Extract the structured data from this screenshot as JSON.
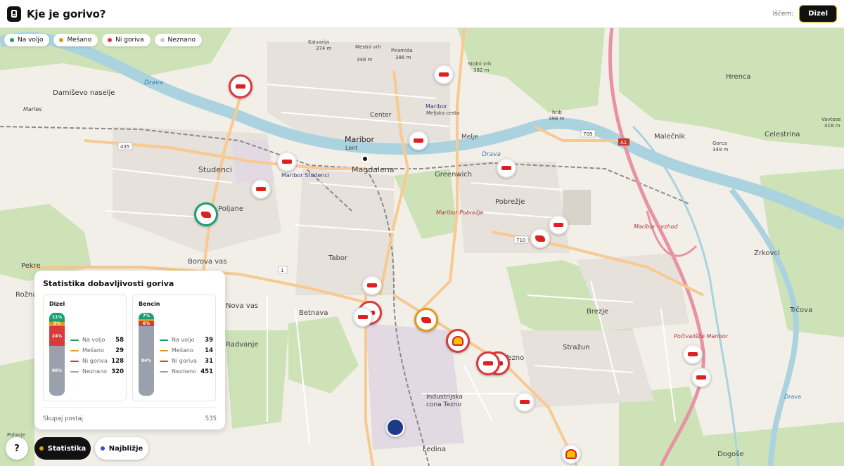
{
  "header": {
    "title": "Kje je gorivo?",
    "search_label": "Iščem:",
    "fuel_button": "Dizel"
  },
  "legend": [
    {
      "label": "Na voljo",
      "color": "#1a9e72"
    },
    {
      "label": "Mešano",
      "color": "#e09a1a"
    },
    {
      "label": "Ni goriva",
      "color": "#d93a3a"
    },
    {
      "label": "Neznano",
      "color": "#c9c9c9"
    }
  ],
  "map_labels": {
    "kalvarija": "Kalvarija",
    "kalvarija_h": "374 m",
    "mestni_vrh": "Mestni vrh",
    "mestni_vrh_h": "348 m",
    "piramida": "Piramida",
    "piramida_h": "386 m",
    "stolni_vrh": "Stolni vrh",
    "stolni_vrh_h": "382 m",
    "damisevo": "Damiševo naselje",
    "marles": "Marles",
    "maribor": "Maribor",
    "center": "Center",
    "lent": "Lent",
    "studenci": "Studenci",
    "maribor_studenci": "Maribor Studenci",
    "magdalena": "Magdalena",
    "poljane": "Poljane",
    "greenwich": "Greenwich",
    "pobrezje": "Pobrežje",
    "maribor_pobrezje": "Maribor Pobrežje",
    "melje": "Melje",
    "maribor_melje": "Maribor",
    "meljska": "Meljska cesta",
    "tabor": "Tabor",
    "borova_vas": "Borova vas",
    "nova_vas": "Nova vas",
    "betnava": "Betnava",
    "radvanje": "Radvanje",
    "brezje": "Brezje",
    "strazun": "Stražun",
    "tezno": "Tezno",
    "industrijska": "Industrijska",
    "cona_tezno": "cona Tezno",
    "ledina": "Ledina",
    "dogose": "Dogoše",
    "malecnik": "Malečnik",
    "celestrina": "Celestrina",
    "hrenca": "Hrenca",
    "zrkovci": "Zrkovci",
    "trcova": "Trčova",
    "maribor_vzhod": "Maribor - vzhod",
    "pocivalisce": "Počivališče Maribor",
    "gorca": "Gorca",
    "gorca_h": "349 m",
    "vavtose": "Vavtose",
    "vavtose_h": "418 m",
    "hrib": "hrib",
    "hrib_h": "398 m",
    "pekre": "Pekre",
    "rozna": "Rožna",
    "drava": "Drava",
    "pohorje": "Pohorje",
    "road_709": "709",
    "road_435": "435",
    "road_710": "710",
    "road_a1": "A1",
    "road_1": "1"
  },
  "stats": {
    "title": "Statistika dobavljivosti goriva",
    "total_label": "Skupaj postaj",
    "total": 535,
    "fuels": [
      {
        "name": "Dizel",
        "rows": [
          {
            "label": "Na voljo",
            "value": 58,
            "color": "#1a9e72",
            "pct": "11%"
          },
          {
            "label": "Mešano",
            "value": 29,
            "color": "#e09a1a",
            "pct": "5%"
          },
          {
            "label": "Ni goriva",
            "value": 128,
            "color": "#d93a3a",
            "pct": "24%"
          },
          {
            "label": "Neznano",
            "value": 320,
            "color": "#9aa1ad",
            "pct": "60%"
          }
        ]
      },
      {
        "name": "Bencin",
        "rows": [
          {
            "label": "Na voljo",
            "value": 39,
            "color": "#1a9e72",
            "pct": "7%"
          },
          {
            "label": "Mešano",
            "value": 14,
            "color": "#e09a1a",
            "pct": ""
          },
          {
            "label": "Ni goriva",
            "value": 31,
            "color": "#d93a3a",
            "pct": "6%"
          },
          {
            "label": "Neznano",
            "value": 451,
            "color": "#9aa1ad",
            "pct": "84%"
          }
        ]
      }
    ]
  },
  "bottom": {
    "help": "?",
    "statistika": "Statistika",
    "najblizje": "Najbližje",
    "stat_dot": "#e09a1a",
    "near_dot": "#3b49d9"
  }
}
